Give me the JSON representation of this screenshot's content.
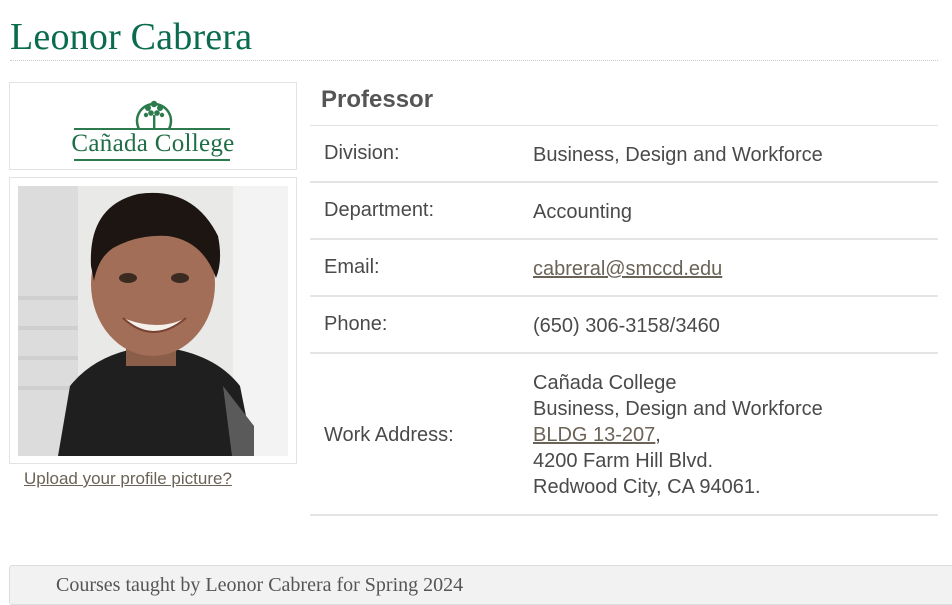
{
  "profile": {
    "name": "Leonor Cabrera",
    "title": "Professor",
    "upload_label": "Upload your profile picture?"
  },
  "logo": {
    "text": "Cañada College",
    "icon": "tree-emblem-icon",
    "brand_color": "#1f6e45"
  },
  "fields": {
    "division": {
      "label": "Division:",
      "value": "Business, Design and Workforce"
    },
    "department": {
      "label": "Department:",
      "value": "Accounting"
    },
    "email": {
      "label": "Email:",
      "value": "cabreral@smccd.edu"
    },
    "phone": {
      "label": "Phone:",
      "value": "(650) 306-3158/3460"
    },
    "address": {
      "label": "Work Address:",
      "line1": "Cañada College",
      "line2": "Business, Design and Workforce",
      "building": "BLDG 13-207",
      "building_suffix": ",",
      "line4": "4200 Farm Hill Blvd.",
      "line5": "Redwood City, CA 94061."
    }
  },
  "panel": {
    "text": "Courses taught by Leonor Cabrera for Spring 2024"
  },
  "colors": {
    "title": "#0a6b4f",
    "link": "#6b6357",
    "text": "#4a4a4a"
  }
}
